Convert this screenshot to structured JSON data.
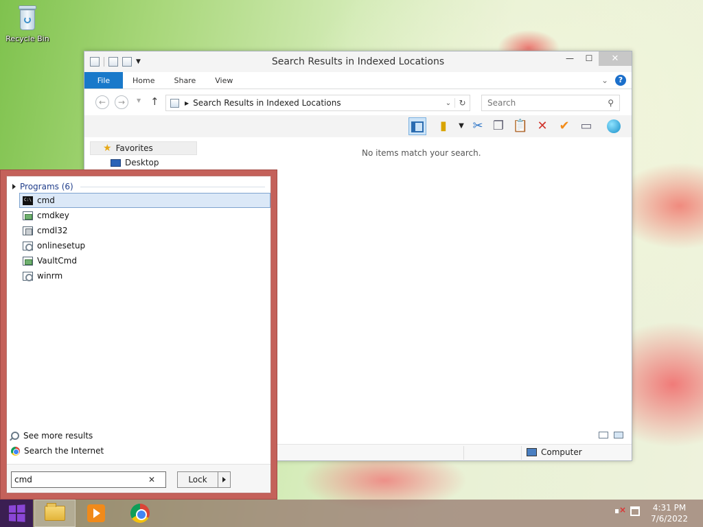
{
  "desktop": {
    "icons": [
      {
        "label": "Recycle Bin",
        "icon": "recycle-bin-icon"
      }
    ]
  },
  "explorer": {
    "title": "Search Results in Indexed Locations",
    "controls": {
      "minimize": "—",
      "maximize": "☐",
      "close": "✕"
    },
    "tabs": [
      {
        "label": "File",
        "active": true
      },
      {
        "label": "Home"
      },
      {
        "label": "Share"
      },
      {
        "label": "View"
      }
    ],
    "help_label": "?",
    "address": {
      "path": "Search Results in Indexed Locations"
    },
    "search": {
      "placeholder": "Search"
    },
    "toolbar_icons": [
      "preview-pane-icon",
      "properties-icon",
      "cut-icon",
      "copy-icon",
      "paste-icon",
      "delete-icon",
      "checkmark-icon",
      "rename-icon",
      "network-globe-icon"
    ],
    "nav": {
      "favorites": "Favorites",
      "desktop": "Desktop"
    },
    "empty_message": "No items match your search.",
    "status": {
      "location": "Computer"
    }
  },
  "start_search": {
    "programs_header": "Programs (6)",
    "programs": [
      {
        "label": "cmd",
        "icon": "console-icon",
        "selected": true
      },
      {
        "label": "cmdkey",
        "icon": "app-icon"
      },
      {
        "label": "cmdl32",
        "icon": "shield-app-icon"
      },
      {
        "label": "onlinesetup",
        "icon": "gear-app-icon"
      },
      {
        "label": "VaultCmd",
        "icon": "app-icon"
      },
      {
        "label": "winrm",
        "icon": "gear-app-icon"
      }
    ],
    "see_more": "See more results",
    "search_internet": "Search the Internet",
    "query": "cmd",
    "lock_label": "Lock"
  },
  "taskbar": {
    "apps": [
      "file-explorer-icon",
      "media-player-icon",
      "chrome-icon"
    ],
    "time": "4:31 PM",
    "date": "7/6/2022"
  },
  "colors": {
    "ribbon_file_tab": "#1979ca",
    "start_panel_frame": "#c4615a",
    "start_button": "#3b1f52",
    "selected_row": "#dbe8f7"
  }
}
